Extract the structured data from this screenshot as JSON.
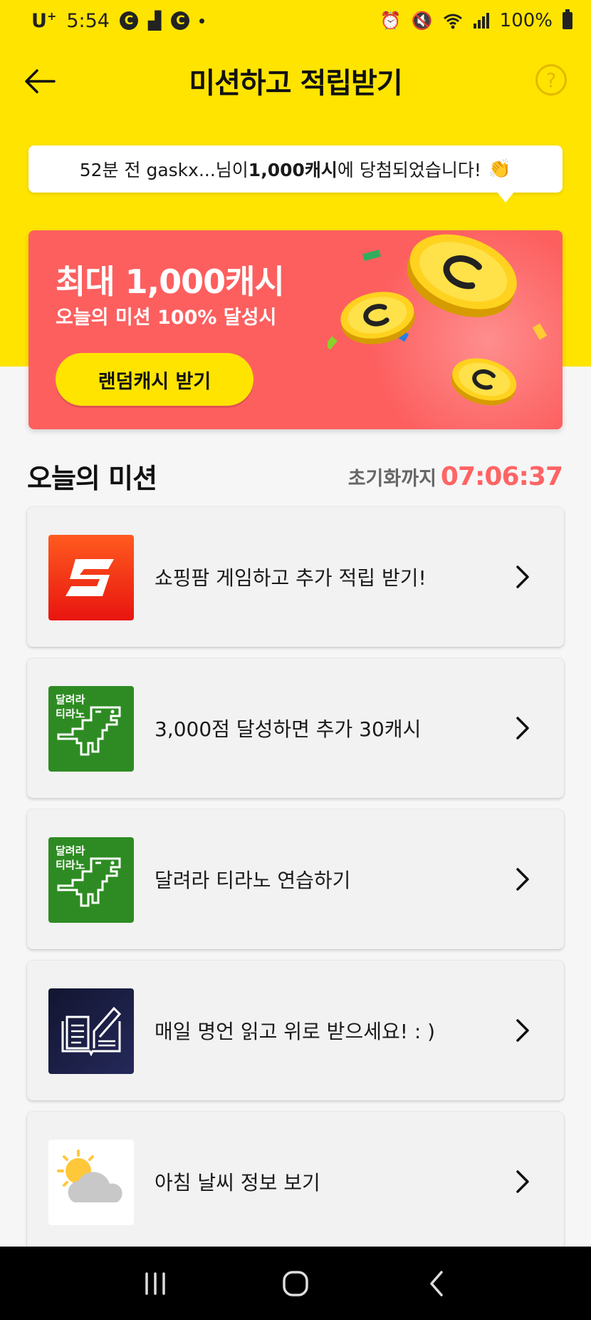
{
  "status_bar": {
    "carrier": "U",
    "carrier_sup": "+",
    "time": "5:54",
    "battery": "100%"
  },
  "header": {
    "title": "미션하고 적립받기",
    "help_label": "?"
  },
  "ticker": {
    "prefix": "52분 전 gaskx...님이 ",
    "highlight": "1,000캐시",
    "suffix": "에 당첨되었습니다!",
    "emoji": "👏"
  },
  "promo": {
    "title": "최대 1,000캐시",
    "subtitle": "오늘의 미션 100% 달성시",
    "button_label": "랜덤캐시 받기",
    "color": "#fd5f5f",
    "accent": "#ffe400"
  },
  "missions_section": {
    "title": "오늘의 미션",
    "reset_label": "초기화까지",
    "reset_time": "07:06:37",
    "timer_color": "#ff6464"
  },
  "missions": [
    {
      "label": "쇼핑팜 게임하고 추가 적립 받기!",
      "icon": "shoppingfarm-s-icon"
    },
    {
      "label": "3,000점 달성하면 추가 30캐시",
      "icon": "tyranno-icon",
      "icon_text_1": "달려라",
      "icon_text_2": "티라노"
    },
    {
      "label": "달려라 티라노 연습하기",
      "icon": "tyranno-icon",
      "icon_text_1": "달려라",
      "icon_text_2": "티라노"
    },
    {
      "label": "매일 명언 읽고 위로 받으세요! : )",
      "icon": "book-pen-icon"
    },
    {
      "label": "아침 날씨 정보 보기",
      "icon": "weather-sun-cloud-icon"
    }
  ]
}
